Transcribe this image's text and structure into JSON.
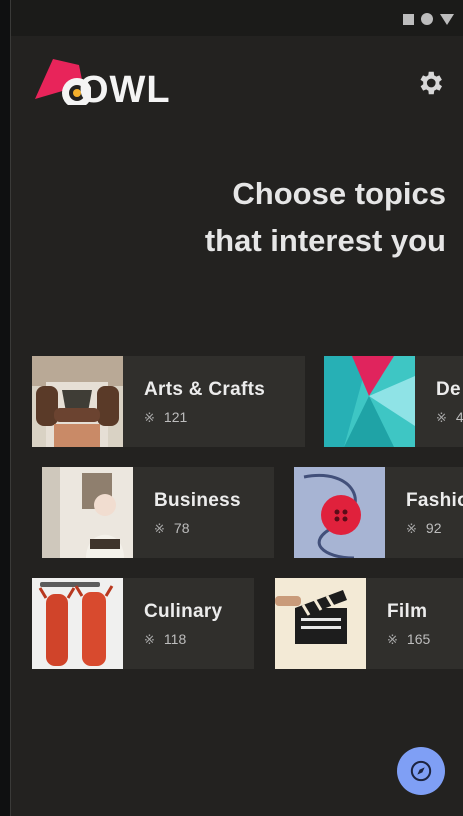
{
  "app": {
    "logo_text": "OWL"
  },
  "header": {
    "title_line1": "Choose topics",
    "title_line2": "that interest you"
  },
  "topics": [
    {
      "title": "Arts & Crafts",
      "count": "121"
    },
    {
      "title": "De",
      "count": "4"
    },
    {
      "title": "Business",
      "count": "78"
    },
    {
      "title": "Fashio",
      "count": "92"
    },
    {
      "title": "Culinary",
      "count": "118"
    },
    {
      "title": "Film",
      "count": "165"
    }
  ],
  "icons": {
    "settings": "gear-icon",
    "fab": "compass-icon",
    "count": "courses-icon"
  },
  "colors": {
    "background": "#232220",
    "card": "#302f2c",
    "brand": "#e8245a",
    "fab": "#7f9ff5"
  }
}
